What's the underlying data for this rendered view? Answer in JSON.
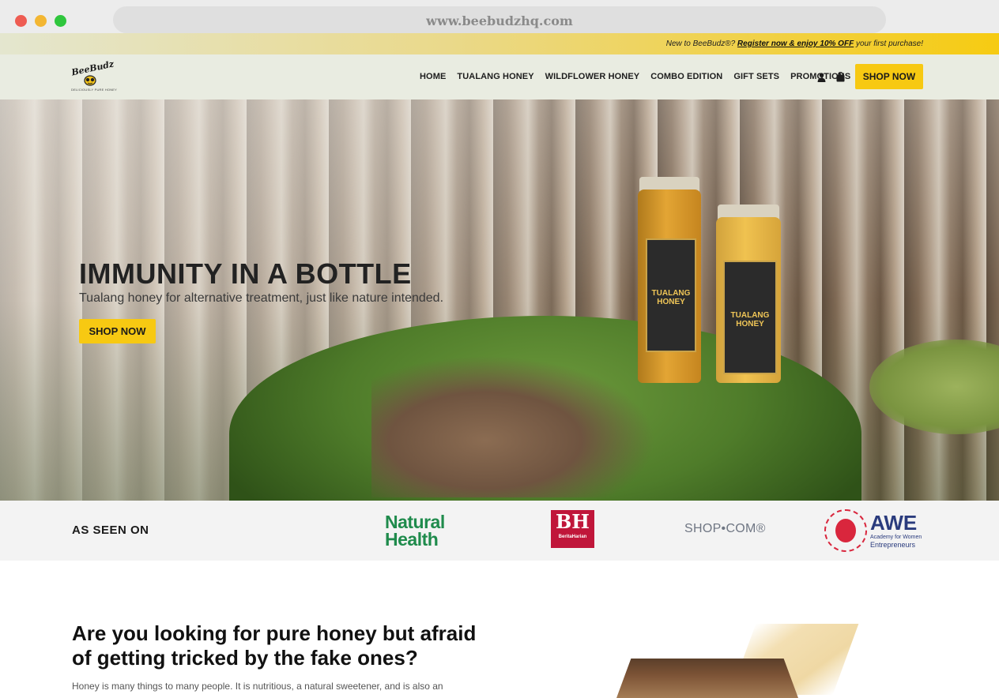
{
  "browser": {
    "url": "www.beebudzhq.com"
  },
  "announcement": {
    "prefix": "New to BeeBudz®? ",
    "link": "Register now & enjoy 10% OFF",
    "suffix": " your first purchase!"
  },
  "header": {
    "logo_text": "BeeBudz",
    "logo_tagline": "DELICIOUSLY PURE HONEY",
    "nav": [
      "HOME",
      "TUALANG HONEY",
      "WILDFLOWER HONEY",
      "COMBO EDITION",
      "GIFT SETS",
      "PROMOTIONS"
    ],
    "icons": [
      "user-icon",
      "shopping-bag-icon"
    ],
    "shop_button": "SHOP NOW"
  },
  "hero": {
    "title": "IMMUNITY IN A BOTTLE",
    "subtitle": "Tualang honey for alternative treatment, just like nature intended.",
    "button": "SHOP NOW",
    "jar_label": "TUALANG HONEY"
  },
  "as_seen_on": {
    "label": "AS SEEN ON",
    "logos": {
      "natural_health_line1": "Natural",
      "natural_health_line2": "Health",
      "bh_big": "BH",
      "bh_small": "BeritaHarian",
      "shopcom": "SHOP•COM®",
      "awe_big": "AWE",
      "awe_line1": "Academy for Women",
      "awe_line2": "Entrepreneurs"
    }
  },
  "section": {
    "title": "Are you looking for pure honey but afraid of getting tricked by the fake ones?",
    "body": "Honey is many things to many people. It is nutritious, a natural sweetener, and is also an"
  },
  "colors": {
    "accent": "#f7c912",
    "header_bg": "#e9ece1",
    "natural_health": "#1f8b4c",
    "bh_red": "#c0163a",
    "awe_navy": "#2a3b7d"
  }
}
